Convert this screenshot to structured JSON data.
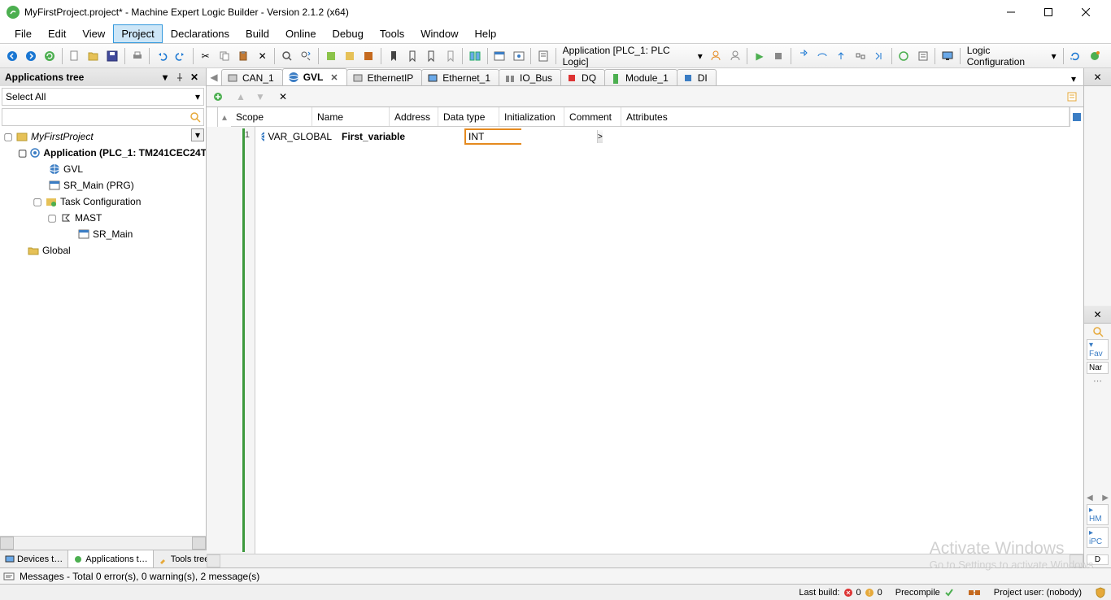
{
  "titlebar": {
    "title": "MyFirstProject.project* - Machine Expert Logic Builder - Version 2.1.2 (x64)"
  },
  "menu": [
    "File",
    "Edit",
    "View",
    "Project",
    "Declarations",
    "Build",
    "Online",
    "Debug",
    "Tools",
    "Window",
    "Help"
  ],
  "menu_active_index": 3,
  "toolbar": {
    "app_context": "Application [PLC_1: PLC Logic]",
    "right_dropdown": "Logic Configuration"
  },
  "leftpanel": {
    "title": "Applications tree",
    "selectall": "Select All",
    "tree": {
      "project": "MyFirstProject",
      "application": "Application (PLC_1: TM241CEC24T",
      "gvl": "GVL",
      "sr_main": "SR_Main (PRG)",
      "task_config": "Task Configuration",
      "mast": "MAST",
      "sr_main_task": "SR_Main",
      "global": "Global"
    },
    "bottom_tabs": [
      "Devices t…",
      "Applications t…",
      "Tools tree"
    ]
  },
  "editor": {
    "tabs": [
      "CAN_1",
      "GVL",
      "EthernetIP",
      "Ethernet_1",
      "IO_Bus",
      "DQ",
      "Module_1",
      "DI"
    ],
    "active_tab_index": 1,
    "grid_headers": [
      "Scope",
      "Name",
      "Address",
      "Data type",
      "Initialization",
      "Comment",
      "Attributes"
    ],
    "row1": {
      "scope": "VAR_GLOBAL",
      "name": "First_variable",
      "datatype_value": "INT",
      "arrow_label": ">"
    },
    "linenumber": "1"
  },
  "rightpanel": {
    "fav": "Fav",
    "nar": "Nar",
    "hm": "HM",
    "ipc": "iPC",
    "d": "D"
  },
  "msgbar": {
    "text": "Messages - Total 0 error(s), 0 warning(s), 2 message(s)"
  },
  "statusbar": {
    "lastbuild_label": "Last build:",
    "err_count": "0",
    "warn_count": "0",
    "precompile": "Precompile",
    "project_user": "Project user: (nobody)"
  },
  "watermark": {
    "line1": "Activate Windows",
    "line2": "Go to Settings to activate Windows."
  }
}
